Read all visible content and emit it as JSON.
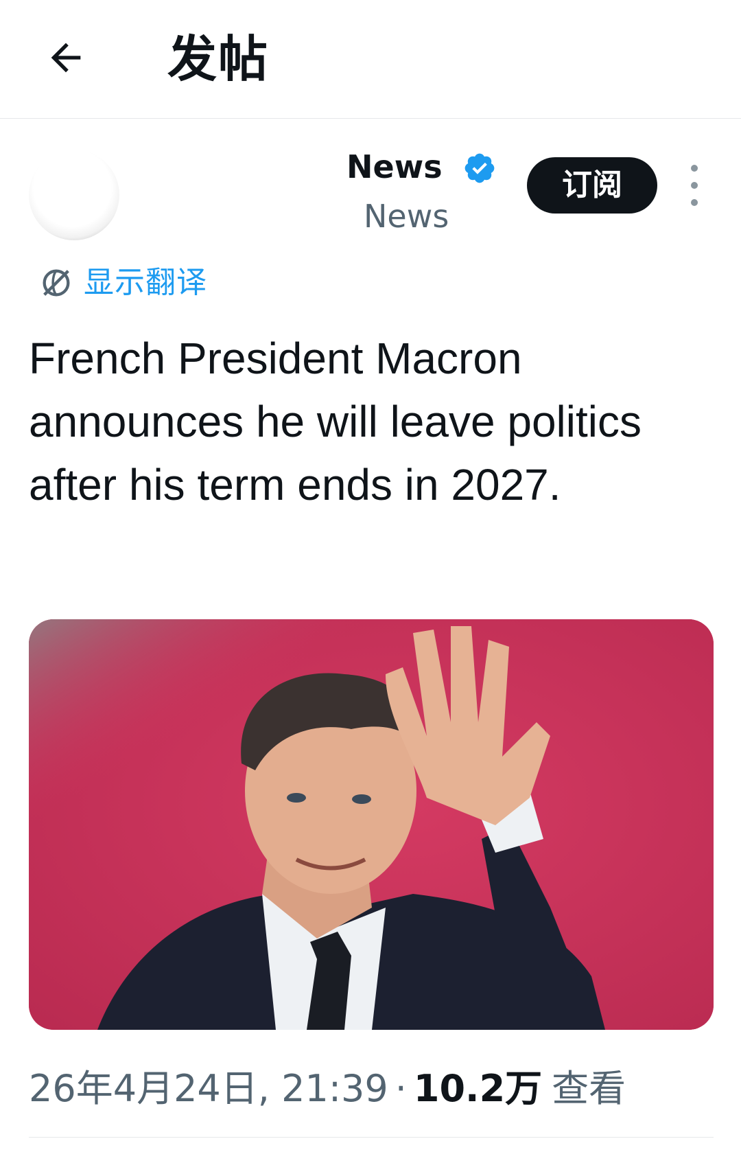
{
  "header": {
    "back_icon": "arrow-left-icon",
    "title": "发帖"
  },
  "author": {
    "display_name": "News",
    "handle": "News",
    "verified_icon": "verified-badge-icon",
    "verified_color": "#1d9bf0",
    "subscribe_label": "订阅",
    "more_icon": "more-vertical-icon"
  },
  "translate": {
    "icon": "translate-globe-icon",
    "label": "显示翻译",
    "color": "#1d9bf0"
  },
  "post": {
    "text": "French President Macron announces he will leave politics after his term ends in 2027."
  },
  "media": {
    "background_color": "#c8325a"
  },
  "meta": {
    "timestamp": "26年4月24日, 21:39",
    "separator": "·",
    "views_count": "10.2万",
    "views_label": "查看"
  }
}
